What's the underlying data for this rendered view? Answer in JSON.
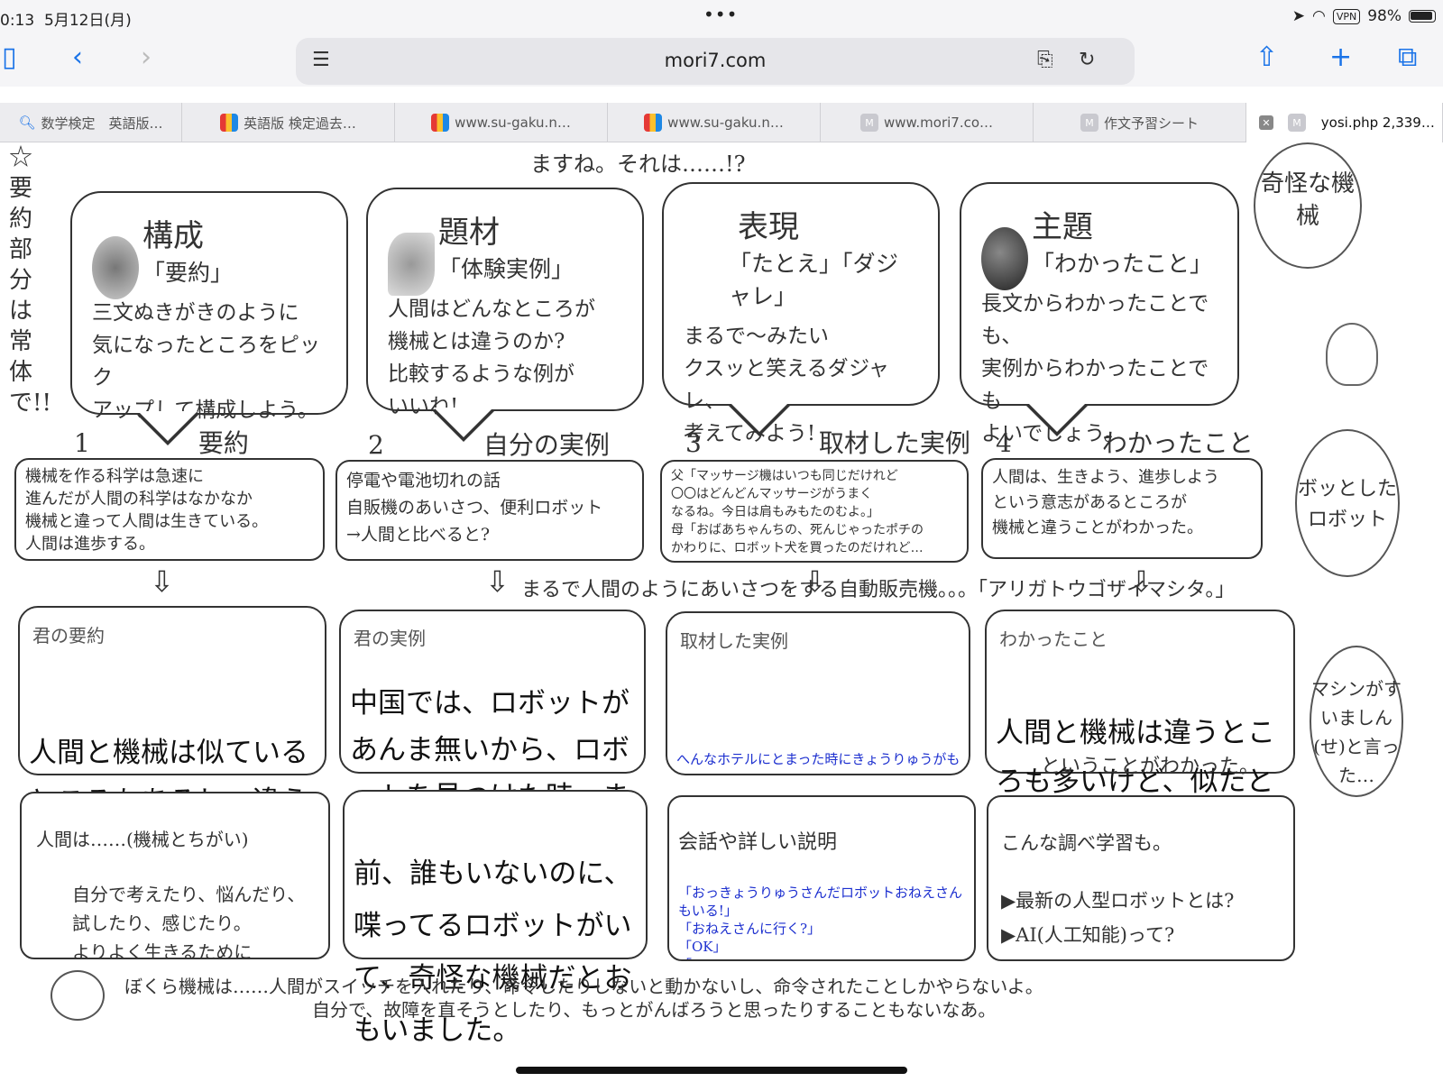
{
  "status": {
    "time": "0:13",
    "date": "5月12日(月)",
    "vpn": "VPN",
    "battery": "98%"
  },
  "browser": {
    "url": "mori7.com",
    "sidebar_icon": "sidebar-icon",
    "back_icon": "chevron-left-icon",
    "forward_icon": "chevron-right-icon",
    "share_icon": "share-icon",
    "new_tab_icon": "plus-icon",
    "tabs_icon": "tabs-icon"
  },
  "tabs": [
    {
      "label": "数学検定　英語版…",
      "icon": "search-icon"
    },
    {
      "label": "英語版 検定過去…",
      "icon": "colorful-favicon"
    },
    {
      "label": "www.su-gaku.n…",
      "icon": "colorful-favicon"
    },
    {
      "label": "www.su-gaku.n…",
      "icon": "colorful-favicon"
    },
    {
      "label": "www.mori7.co…",
      "icon": "m-favicon"
    },
    {
      "label": "作文予習シート",
      "icon": "m-favicon"
    },
    {
      "label": "yosi.php 2,339…",
      "icon": "m-favicon"
    }
  ],
  "page": {
    "top_text": "ますね。それは……!?",
    "side_note": "☆要約部分は常体で!!",
    "bubbles": [
      {
        "title": "構成",
        "sub": "「要約」",
        "desc": "三文ぬきがきのように\n気になったところをピック\nアップして構成しよう。"
      },
      {
        "title": "題材",
        "sub": "「体験実例」",
        "desc": "人間はどんなところが\n機械とは違うのか?\n比較するような例が\nいいね!"
      },
      {
        "title": "表現",
        "sub": "「たとえ」「ダジャレ」",
        "desc": "まるで〜みたい\nクスッと笑えるダジャレ、\n考えてみよう!"
      },
      {
        "title": "主題",
        "sub": "「わかったこと」",
        "desc": "長文からわかったことでも、\n実例からわかったことでも\nよいでしょう。"
      }
    ],
    "steps": [
      {
        "num": "1",
        "label": "要約",
        "text": "機械を作る科学は急速に\n進んだが人間の科学はなかなか\n機械と違って人間は生きている。\n人間は進歩する。"
      },
      {
        "num": "2",
        "label": "自分の実例",
        "text": "停電や電池切れの話\n自販機のあいさつ、便利ロボット\n→人間と比べると?"
      },
      {
        "num": "3",
        "label": "取材した実例",
        "text": "父「マッサージ機はいつも同じだけれど\n〇〇はどんどんマッサージがうまく\nなるね。今日は肩もみもたのむよ。」\n母「おばあちゃんちの、死んじゃったポチの\nかわりに、ロボット犬を買ったのだけれど…"
      },
      {
        "num": "4",
        "label": "わかったこと",
        "text": "人間は、生きよう、進歩しよう\nという意志があるところが\n機械と違うことがわかった。"
      }
    ],
    "middle_note": "まるで人間のようにあいさつをする自動販売機。。。「アリガトウゴザイマシタ。」",
    "typed_boxes": [
      {
        "label": "君の要約",
        "text": "人間と機械は似ているところもあるし、違うところもある。たとえば…"
      },
      {
        "label": "君の実例",
        "text": "中国では、ロボットがあんま無いから、ロボットを見つけた時，まわりにいっぱいの子供達がいる"
      },
      {
        "label": "取材した実例",
        "text": "へんなホテルにとまった時にきょうりゅうがもりつけたがもんだいがはっせいした時本物の人間が出てきて、ほとうのへんなホテルだ、と思った。"
      },
      {
        "label": "わかったこと",
        "text": "人間と機械は違うところも多いけど、似たところもあるなぁ、"
      }
    ],
    "typed_tail": "ということがわかった。",
    "lower_boxes": [
      {
        "title": "人間は……(機械とちがい)",
        "text": "自分で考えたり、悩んだり、\n試したり、感じたり。\nよりよく生きるために\n進歩するようになっている。"
      },
      {
        "title": "",
        "text": "前、誰もいないのに、喋ってるロボットがいて、奇怪な機械だとおもいました。"
      },
      {
        "title": "会話や詳しい説明",
        "text": "「おっきょうりゅうさんだロボットおねえさんもいる!」\n「おねえさんに行く?」\n「OK」\n「〜〜」\n「このおねえさんしゃべって時き口がうごいてない!こわ〜い!」"
      },
      {
        "title": "こんな調べ学習も。",
        "text": "▶最新の人型ロボットとは?\n▶AI(人工知能)って?\n▶自動〜機はどんなものがある?"
      }
    ],
    "robot_line1": "ぼくら機械は……人間がスイッチを入れたり、命令したりしないと動かないし、命令されたことしかやらないよ。",
    "robot_line2": "自分で、故障を直そうとしたり、もっとがんばろうと思ったりすることもないなあ。",
    "balloons": [
      "奇怪な機械",
      "ボッとしたロボット",
      "マシンがすいましん(せ)と言った…"
    ]
  }
}
